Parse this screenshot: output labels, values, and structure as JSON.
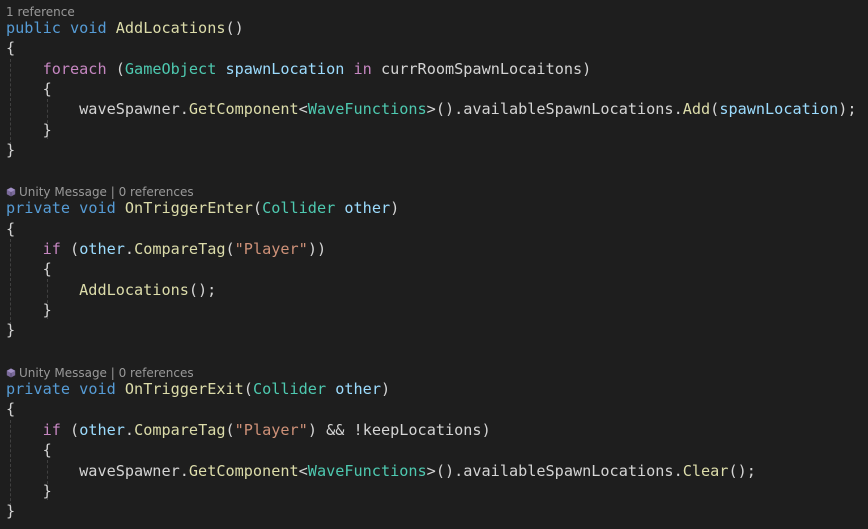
{
  "code_lens": {
    "add_locations": "1 reference",
    "unity_message": "Unity Message",
    "separator": " | ",
    "zero_references": "0 references"
  },
  "icons": {
    "unity": "unity-message-icon"
  },
  "colors": {
    "background": "#1e1e1e",
    "keyword": "#569cd6",
    "control_keyword": "#c586c0",
    "type": "#4ec9b0",
    "method": "#dcdcaa",
    "variable": "#9cdcfe",
    "string": "#ce9178",
    "text": "#d4d4d4",
    "codelens": "#999999"
  },
  "code": {
    "kw_public": "public",
    "kw_private": "private",
    "kw_void": "void",
    "kw_foreach": "foreach",
    "kw_in": "in",
    "kw_if": "if",
    "type_gameobject": "GameObject",
    "type_collider": "Collider",
    "type_wavefunctions": "WaveFunctions",
    "fn_addlocations": "AddLocations",
    "fn_ontriggerenter": "OnTriggerEnter",
    "fn_ontriggerexit": "OnTriggerExit",
    "fn_getcomponent": "GetComponent",
    "fn_add": "Add",
    "fn_clear": "Clear",
    "fn_comparetag": "CompareTag",
    "var_spawnlocation": "spawnLocation",
    "var_other": "other",
    "str_player": "\"Player\"",
    "field_currroom": "currRoomSpawnLocaitons",
    "field_wavespawner": "waveSpawner",
    "field_available": "availableSpawnLocations",
    "field_keeplocations": "keepLocations",
    "p_open": "(",
    "p_close": ")",
    "p_empty_call": "()",
    "p_empty_stmt": "();",
    "p_close_stmt": ");",
    "p_close_close": "))",
    "p_dot": ".",
    "p_lt": "<",
    "p_gt_call_dot": ">().",
    "p_and_not": " && !",
    "brace_open": "{",
    "brace_close": "}"
  }
}
